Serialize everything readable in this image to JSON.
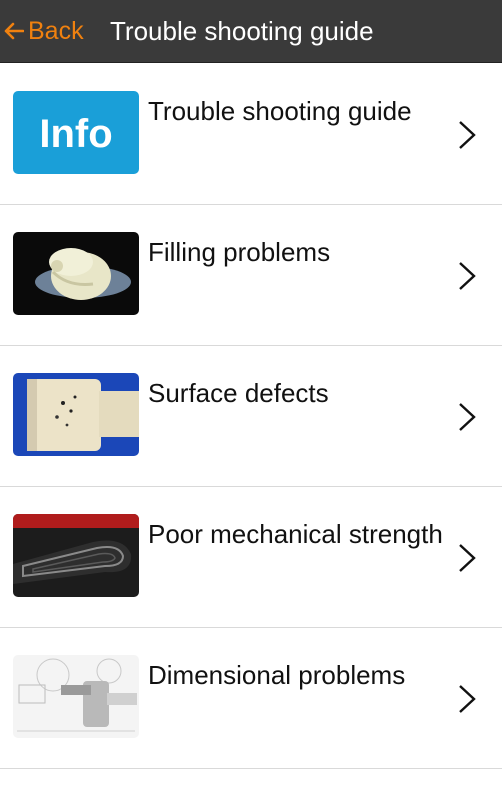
{
  "header": {
    "back_label": "Back",
    "back_icon": "arrow-left-icon",
    "title": "Trouble shooting guide",
    "back_color": "#f0810f",
    "bar_color": "#3a3a3a"
  },
  "items": [
    {
      "label": "Trouble shooting guide",
      "thumb": "info-thumbnail",
      "thumb_text": "Info"
    },
    {
      "label": "Filling problems",
      "thumb": "filling-problems-thumbnail"
    },
    {
      "label": "Surface defects",
      "thumb": "surface-defects-thumbnail"
    },
    {
      "label": "Poor mechanical strength",
      "thumb": "mechanical-strength-thumbnail"
    },
    {
      "label": "Dimensional problems",
      "thumb": "dimensional-problems-thumbnail"
    }
  ]
}
